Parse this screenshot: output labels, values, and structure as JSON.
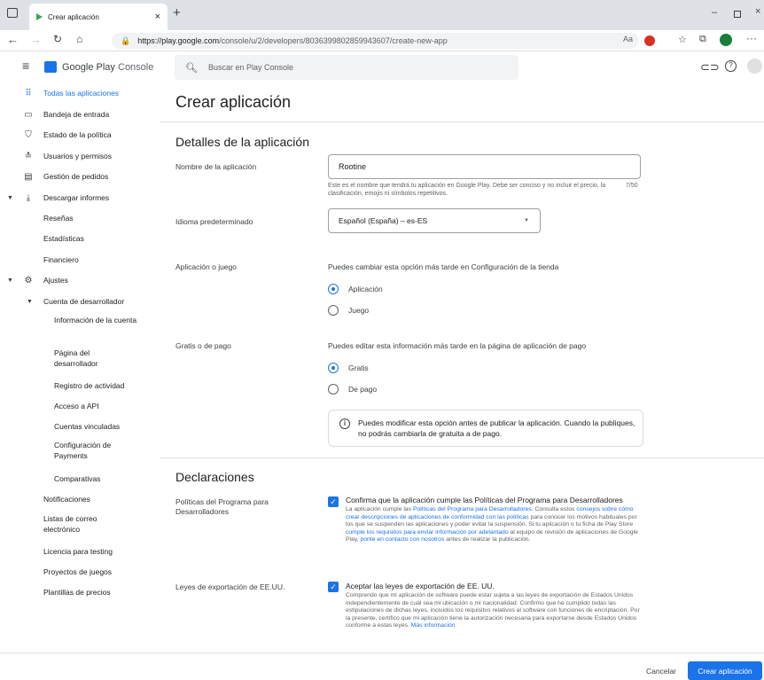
{
  "browser": {
    "tab_title": "Crear aplicación",
    "url_host": "https://play.google.com",
    "url_path": "/console/u/2/developers/8036399802859943607/create-new-app"
  },
  "header": {
    "logo_text": "Google Play",
    "logo_suffix": "Console",
    "search_placeholder": "Buscar en Play Console"
  },
  "sidebar": {
    "items": [
      {
        "label": "Todas las aplicaciones",
        "icon": "apps-grid-icon"
      },
      {
        "label": "Bandeja de entrada",
        "icon": "inbox-icon"
      },
      {
        "label": "Estado de la política",
        "icon": "shield-icon"
      },
      {
        "label": "Usuarios y permisos",
        "icon": "users-icon"
      },
      {
        "label": "Gestión de pedidos",
        "icon": "card-icon"
      },
      {
        "label": "Descargar informes",
        "icon": "download-icon"
      },
      {
        "label": "Reseñas"
      },
      {
        "label": "Estadísticas"
      },
      {
        "label": "Financiero"
      },
      {
        "label": "Ajustes",
        "icon": "gear-icon"
      },
      {
        "label": "Cuenta de desarrollador"
      },
      {
        "label": "Información de la cuenta"
      },
      {
        "label": "Página del desarrollador"
      },
      {
        "label": "Registro de actividad"
      },
      {
        "label": "Acceso a API"
      },
      {
        "label": "Cuentas vinculadas"
      },
      {
        "label": "Configuración de Payments"
      },
      {
        "label": "Comparativas"
      },
      {
        "label": "Notificaciones"
      },
      {
        "label": "Listas de correo electrónico"
      },
      {
        "label": "Licencia para testing"
      },
      {
        "label": "Proyectos de juegos"
      },
      {
        "label": "Plantillas de precios"
      }
    ]
  },
  "page": {
    "title": "Crear aplicación",
    "section_details": "Detalles de la aplicación",
    "app_name_label": "Nombre de la aplicación",
    "app_name_value": "Rootine",
    "app_name_help": "Este es el nombre que tendrá tu aplicación en Google Play. Debe ser conciso y no incluir el precio, la clasificación, emojis ni símbolos repetitivos.",
    "app_name_counter": "7/50",
    "lang_label": "Idioma predeterminado",
    "lang_value": "Español (España) – es-ES",
    "type_label": "Aplicación o juego",
    "type_help": "Puedes cambiar esta opción más tarde en Configuración de la tienda",
    "type_opt1": "Aplicación",
    "type_opt2": "Juego",
    "price_label": "Gratis o de pago",
    "price_help": "Puedes editar esta información más tarde en la página de aplicación de pago",
    "price_opt1": "Gratis",
    "price_opt2": "De pago",
    "info_text": "Puedes modificar esta opción antes de publicar la aplicación. Cuando la publiques, no podrás cambiarla de gratuita a de pago.",
    "section_decl": "Declaraciones",
    "policy_label": "Políticas del Programa para Desarrolladores",
    "policy_check": "Confirma que la aplicación cumple las Políticas del Programa para Desarrolladores",
    "policy_t1": "La aplicación cumple las ",
    "policy_l1": "Políticas del Programa para Desarrolladores",
    "policy_t2": ". Consulta estos ",
    "policy_l2": "consejos sobre cómo crear descripciones de aplicaciones de conformidad con las políticas",
    "policy_t3": " para conocer los motivos habituales por los que se suspenden las aplicaciones y poder evitar la suspensión. Si tu aplicación o tu ficha de Play Store ",
    "policy_l3": "cumple los requisitos para enviar información por adelantado",
    "policy_t4": " al equipo de revisión de aplicaciones de Google Play, ",
    "policy_l4": "ponte en contacto con nosotros",
    "policy_t5": " antes de realizar la publicación.",
    "export_label": "Leyes de exportación de EE.UU.",
    "export_check": "Aceptar las leyes de exportación de EE. UU.",
    "export_text": "Comprendo que mi aplicación de software puede estar sujeta a las leyes de exportación de Estados Unidos independientemente de cuál sea mi ubicación o mi nacionalidad. Confirmo que he cumplido todas las estipulaciones de dichas leyes, incluidos los requisitos relativos al software con funciones de encriptación. Por la presente, certifico que mi aplicación tiene la autorización necesaria para exportarse desde Estados Unidos conforme a estas leyes. ",
    "export_link": "Más información",
    "cancel": "Cancelar",
    "create": "Crear aplicación"
  },
  "colors": {
    "accent": "#1a73e8"
  }
}
